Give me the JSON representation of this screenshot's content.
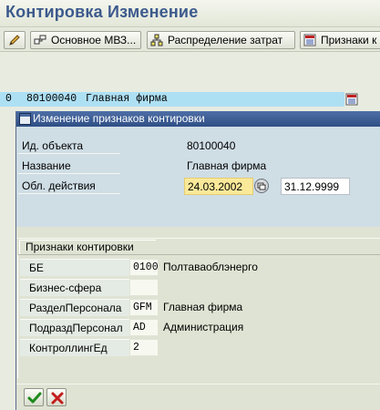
{
  "window": {
    "title": "Контировка Изменение"
  },
  "toolbar": {
    "buttons": [
      {
        "label": "Основное МВЗ...",
        "icon": "overview-icon"
      },
      {
        "label": "Распределение затрат",
        "icon": "cost-distribution-icon"
      },
      {
        "label": "Признаки к",
        "icon": "account-features-icon"
      }
    ]
  },
  "list_row": {
    "col1": "0",
    "col2": "80100040",
    "col3": "Главная фирма",
    "icon": "details-icon"
  },
  "dialog": {
    "title": "Изменение признаков контировки",
    "fields": {
      "object_id_label": "Ид. объекта",
      "object_id_value": "80100040",
      "name_label": "Название",
      "name_value": "Главная фирма",
      "validity_label": "Обл. действия",
      "valid_from": "24.03.2002",
      "valid_to": "31.12.9999"
    },
    "group": {
      "title": "Признаки контировки",
      "rows": [
        {
          "label": "БЕ",
          "code": "0100",
          "text": "Полтаваоблэнерго"
        },
        {
          "label": "Бизнес-сфера",
          "code": "",
          "text": ""
        },
        {
          "label": "РазделПерсонала",
          "code": "GFM",
          "text": "Главная фирма"
        },
        {
          "label": "ПодраздПерсонал",
          "code": "AD",
          "text": "Администрация"
        },
        {
          "label": "КонтроллингЕд",
          "code": "2",
          "text": ""
        }
      ]
    },
    "footer": {
      "confirm_icon": "checkmark-icon",
      "cancel_icon": "cancel-icon"
    }
  },
  "colors": {
    "title_text": "#3c5a8c",
    "dialog_header": "#2f4f85",
    "highlight_row": "#aee0f4",
    "date_field": "#fbe99a"
  }
}
